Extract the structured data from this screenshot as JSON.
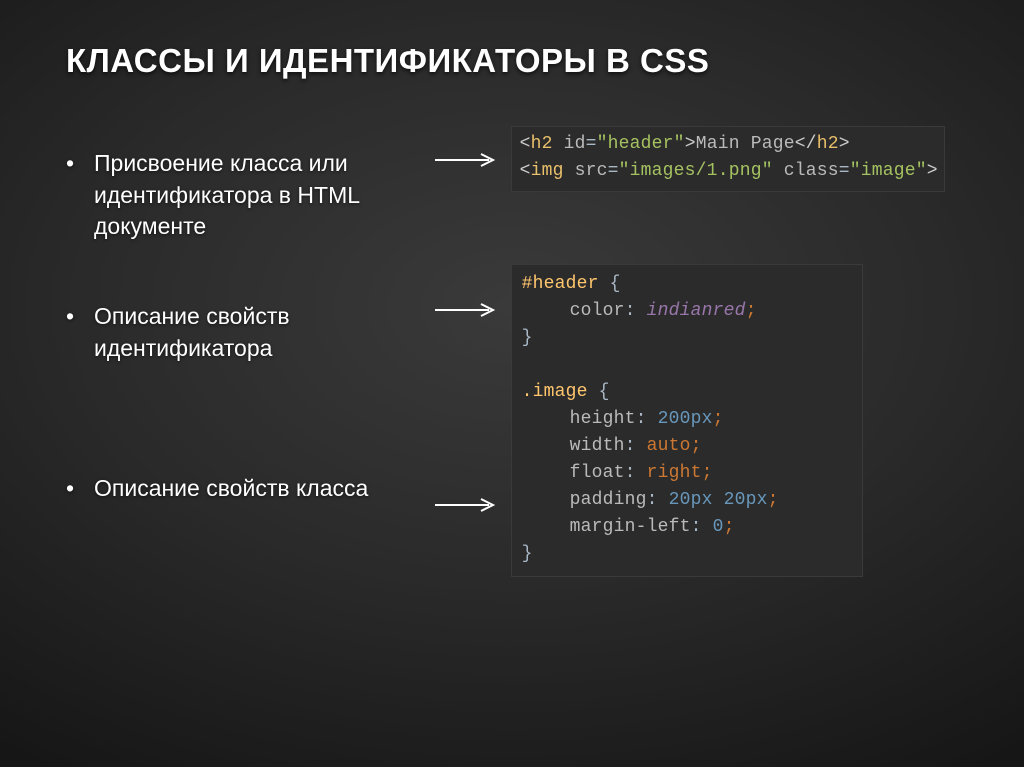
{
  "title": "КЛАССЫ И ИДЕНТИФИКАТОРЫ В CSS",
  "bullets": {
    "b1": "Присвоение класса или идентификатора в HTML документе",
    "b2": "Описание свойств идентификатора",
    "b3": "Описание свойств класса"
  },
  "code1": {
    "h2": {
      "tag": "h2",
      "idAttr": "id",
      "idVal": "\"header\"",
      "text": "Main Page"
    },
    "img": {
      "tag": "img",
      "srcAttr": "src",
      "srcVal": "\"images/1.png\"",
      "classAttr": "class",
      "classVal": "\"image\""
    }
  },
  "code2": {
    "idSel": "#header",
    "idRules": {
      "color": {
        "prop": "color",
        "val": "indianred"
      }
    },
    "clsSel": ".image",
    "clsRules": {
      "height": {
        "prop": "height",
        "val": "200px"
      },
      "width": {
        "prop": "width",
        "val": "auto"
      },
      "float": {
        "prop": "float",
        "val": "right"
      },
      "padding": {
        "prop": "padding",
        "val": "20px 20px"
      },
      "margin": {
        "prop": "margin-left",
        "val": "0"
      }
    }
  }
}
